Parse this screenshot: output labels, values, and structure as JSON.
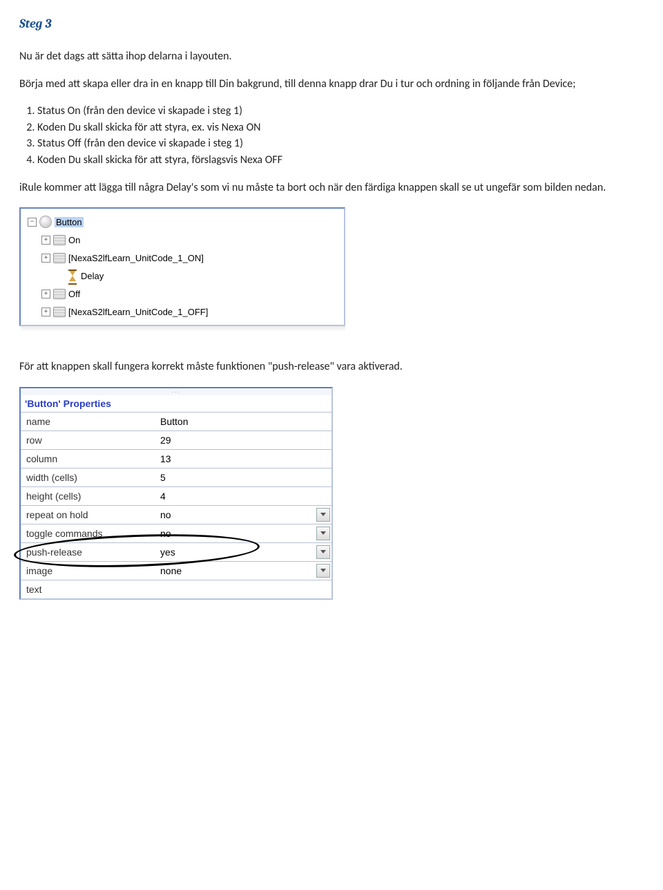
{
  "heading": "Steg 3",
  "intro": "Nu är det dags att sätta ihop delarna i layouten.",
  "intro2": "Börja med att skapa eller dra in en knapp till Din bakgrund,  till denna knapp drar Du i tur och ordning in följande från Device;",
  "steps": [
    "Status On (från den device vi skapade i steg 1)",
    "Koden Du skall skicka för att styra, ex. vis Nexa ON",
    "Status Off (från den device vi skapade i steg 1)",
    "Koden Du skall skicka för att styra, förslagsvis Nexa OFF"
  ],
  "after_list": "iRule kommer att lägga till några Delay's som vi nu måste ta bort och när den färdiga knappen skall se ut ungefär som bilden nedan.",
  "tree": {
    "root": "Button",
    "items": [
      "On",
      "[NexaS2lfLearn_UnitCode_1_ON]",
      "Delay",
      "Off",
      "[NexaS2lfLearn_UnitCode_1_OFF]"
    ]
  },
  "mid_text": "För att knappen skall fungera korrekt måste funktionen \"push-release\" vara aktiverad.",
  "props": {
    "title": "'Button' Properties",
    "rows": [
      {
        "label": "name",
        "value": "Button",
        "dd": false
      },
      {
        "label": "row",
        "value": "29",
        "dd": false
      },
      {
        "label": "column",
        "value": "13",
        "dd": false
      },
      {
        "label": "width (cells)",
        "value": "5",
        "dd": false
      },
      {
        "label": "height (cells)",
        "value": "4",
        "dd": false
      },
      {
        "label": "repeat on hold",
        "value": "no",
        "dd": true
      },
      {
        "label": "toggle commands",
        "value": "no",
        "dd": true
      },
      {
        "label": "push-release",
        "value": "yes",
        "dd": true
      },
      {
        "label": "image",
        "value": "none",
        "dd": true
      },
      {
        "label": "text",
        "value": "",
        "dd": false
      }
    ]
  }
}
